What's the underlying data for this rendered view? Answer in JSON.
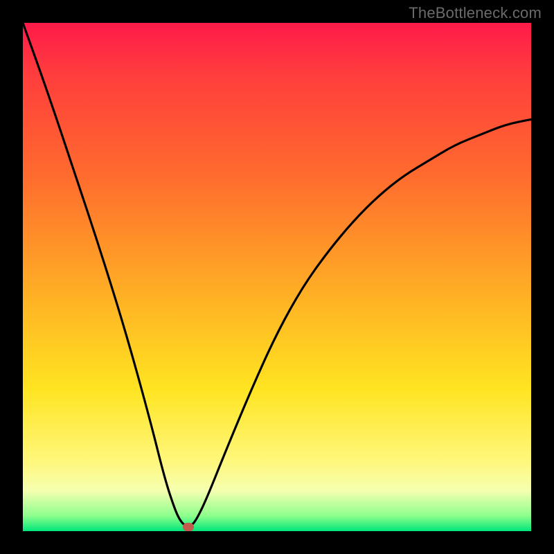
{
  "attribution": "TheBottleneck.com",
  "colors": {
    "frame": "#000000",
    "curve": "#000000",
    "marker": "#c25a4e"
  },
  "chart_data": {
    "type": "line",
    "title": "",
    "xlabel": "",
    "ylabel": "",
    "xlim": [
      0,
      100
    ],
    "ylim": [
      0,
      100
    ],
    "grid": false,
    "legend": false,
    "annotations": [],
    "series": [
      {
        "name": "curve",
        "x": [
          0,
          5,
          10,
          15,
          20,
          25,
          28,
          30,
          31,
          32,
          33,
          34,
          36,
          40,
          45,
          50,
          55,
          60,
          65,
          70,
          75,
          80,
          85,
          90,
          95,
          100
        ],
        "y": [
          100,
          86,
          71,
          56,
          40,
          22,
          10,
          4,
          2,
          1,
          1,
          2,
          6,
          16,
          28,
          39,
          48,
          55,
          61,
          66,
          70,
          73,
          76,
          78,
          80,
          81
        ]
      }
    ],
    "marker": {
      "x": 32.5,
      "y": 0.8
    },
    "note": "y expressed as percent of plot height from bottom (0 = bottom green band, 100 = top red). Values read from pixel positions of the black curve against the 734x734 plot area."
  }
}
